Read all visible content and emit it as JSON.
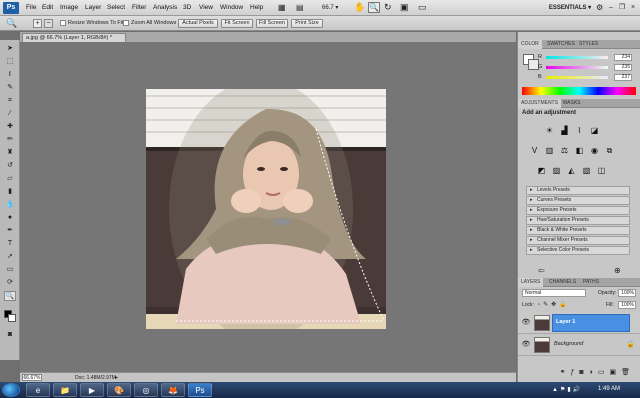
{
  "app": {
    "logo": "Ps",
    "workspace": "ESSENTIALS ▾"
  },
  "menu": [
    "File",
    "Edit",
    "Image",
    "Layer",
    "Select",
    "Filter",
    "Analysis",
    "3D",
    "View",
    "Window",
    "Help"
  ],
  "zoom_menu": "66.7 ▾",
  "options": {
    "resize_windows": "Resize Windows To Fit",
    "zoom_all": "Zoom All Windows",
    "actual_pixels": "Actual Pixels",
    "fit_screen": "Fit Screen",
    "fill_screen": "Fill Screen",
    "print_size": "Print Size"
  },
  "document": {
    "tab_title": "a.jpg @ 66.7% (Layer 1, RGB/8#) *",
    "zoom": "66.67%",
    "doc_info": "Doc: 1.48M/2.97M"
  },
  "color_panel": {
    "tabs": [
      "COLOR",
      "SWATCHES",
      "STYLES"
    ],
    "channels": [
      {
        "label": "R",
        "value": "234"
      },
      {
        "label": "G",
        "value": "235"
      },
      {
        "label": "B",
        "value": "237"
      }
    ]
  },
  "adjustments_panel": {
    "tabs": [
      "ADJUSTMENTS",
      "MASKS"
    ],
    "heading": "Add an adjustment",
    "presets": [
      "Levels Presets",
      "Curves Presets",
      "Exposure Presets",
      "Hue/Saturation Presets",
      "Black & White Presets",
      "Channel Mixer Presets",
      "Selective Color Presets"
    ]
  },
  "layers_panel": {
    "tabs": [
      "LAYERS",
      "CHANNELS",
      "PATHS"
    ],
    "blend_mode": "Normal",
    "opacity_label": "Opacity:",
    "opacity": "100%",
    "lock_label": "Lock:",
    "fill_label": "Fill:",
    "fill": "100%",
    "layers": [
      "Layer 1",
      "Background"
    ]
  },
  "taskbar": {
    "clock": "1:49 AM"
  },
  "colors": {
    "accent": "#3d8ee8",
    "selected_layer": "#4a90e2",
    "ps_blue": "#1d5fa8"
  }
}
